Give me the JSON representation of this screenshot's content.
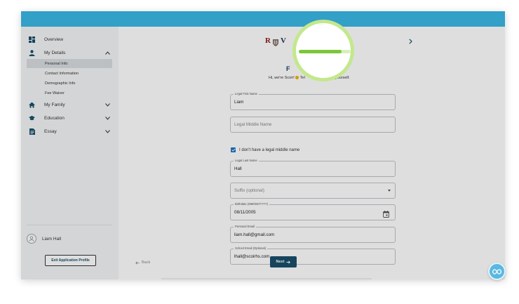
{
  "sidebar": {
    "items": [
      {
        "label": "Overview",
        "icon": "dashboard-icon"
      },
      {
        "label": "My Details",
        "icon": "person-icon",
        "expanded": true,
        "children": [
          {
            "label": "Personal Info",
            "active": true
          },
          {
            "label": "Contact Information"
          },
          {
            "label": "Demographic Info"
          },
          {
            "label": "Fee Waiver"
          }
        ]
      },
      {
        "label": "My Family",
        "icon": "home-icon",
        "expanded": false
      },
      {
        "label": "Education",
        "icon": "graduation-cap-icon",
        "expanded": false
      },
      {
        "label": "Essay",
        "icon": "document-icon",
        "expanded": false
      }
    ],
    "user": {
      "name": "Liam Hall"
    },
    "exit_label": "Exit Application Profile"
  },
  "header": {
    "logo_letters": [
      "R",
      "V"
    ]
  },
  "main": {
    "heading_visible": "F",
    "greeting_start": "Hi, we're Scoir! ",
    "greeting_middle": " Tel",
    "greeting_end": "t yourself.",
    "progress": 0.82,
    "fields": {
      "first_name": {
        "label": "Legal First Name",
        "value": "Liam"
      },
      "middle_name": {
        "placeholder": "Legal Middle Name"
      },
      "no_middle_name": {
        "label": "I don't have a legal middle name",
        "checked": true
      },
      "last_name": {
        "label": "Legal Last Name",
        "value": "Hall"
      },
      "suffix": {
        "placeholder": "Suffix (optional)"
      },
      "birthdate": {
        "label": "Birthdate (MM/DD/YYYY)",
        "value": "08/11/2005"
      },
      "personal_email": {
        "label": "Personal Email",
        "value": "liam.hall@gmail.com"
      },
      "school_email": {
        "label": "School Email (Optional)",
        "value": "lhall@scoirhs.com"
      }
    },
    "back_label": "Back",
    "next_label": "Next"
  },
  "colors": {
    "topbar": "#3ab8e5",
    "primary": "#1a4f6b",
    "checkbox": "#1a73c0",
    "progress": "#7cc63a",
    "spotlight_ring": "#c3e88d"
  }
}
